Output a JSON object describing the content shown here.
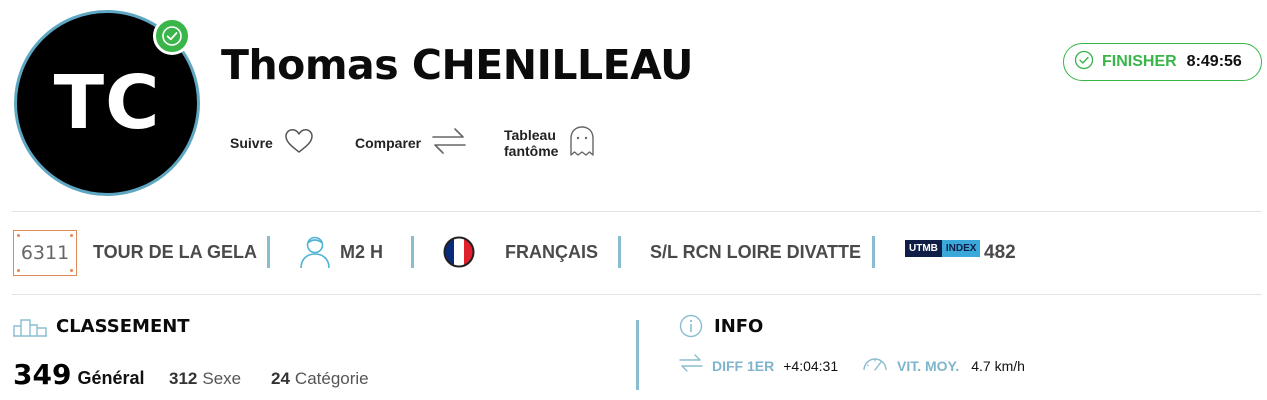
{
  "runner": {
    "initials": "TC",
    "name": "Thomas CHENILLEAU"
  },
  "status": {
    "label": "FINISHER",
    "time": "8:49:56",
    "color": "#39b54a"
  },
  "actions": [
    {
      "label": "Suivre",
      "icon": "heart-icon"
    },
    {
      "label": "Comparer",
      "icon": "compare-arrows-icon"
    },
    {
      "label": "Tableau fantôme",
      "icon": "ghost-icon"
    }
  ],
  "infobar": {
    "bib": "6311",
    "race": "TOUR DE LA GELA",
    "category": "M2 H",
    "nationality": "FRANÇAIS",
    "club": "S/L RCN LOIRE DIVATTE",
    "utmb_index_logo": {
      "part1": "UTMB",
      "part2": "INDEX"
    },
    "utmb_index": "482"
  },
  "ranking": {
    "title": "CLASSEMENT",
    "general": {
      "value": "349",
      "label": "Général"
    },
    "sexe": {
      "value": "312",
      "label": "Sexe"
    },
    "categorie": {
      "value": "24",
      "label": "Catégorie"
    }
  },
  "info": {
    "title": "INFO",
    "diff_label": "DIFF 1ER",
    "diff_value": "+4:04:31",
    "speed_label": "VIT. MOY.",
    "speed_value": "4.7 km/h"
  },
  "colors": {
    "accent_blue": "#8bbdd1",
    "bib_orange": "#e08a55",
    "finisher_green": "#39b54a"
  }
}
